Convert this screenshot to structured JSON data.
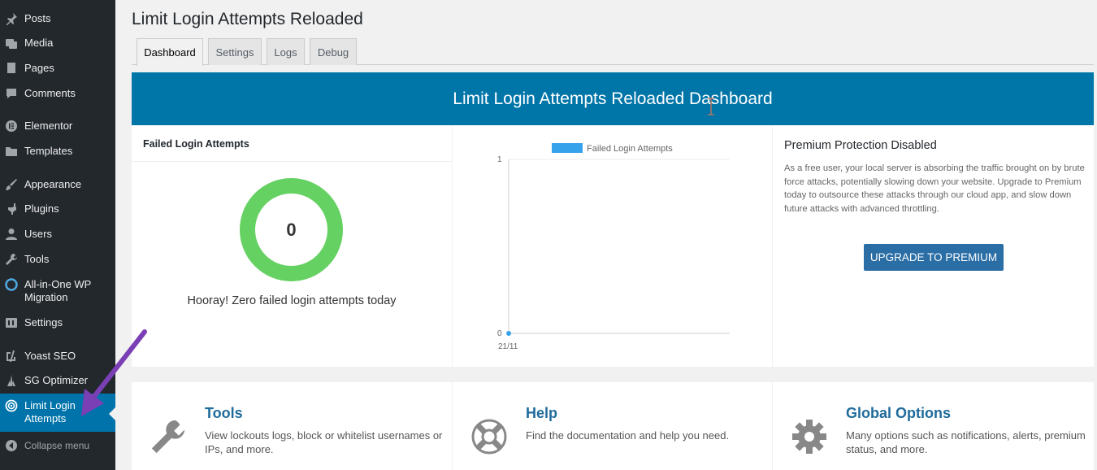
{
  "sidebar": {
    "items": [
      {
        "label": "Posts",
        "icon": "pin-icon"
      },
      {
        "label": "Media",
        "icon": "media-icon"
      },
      {
        "label": "Pages",
        "icon": "pages-icon"
      },
      {
        "label": "Comments",
        "icon": "comments-icon"
      },
      {
        "label": "Elementor",
        "icon": "elementor-icon"
      },
      {
        "label": "Templates",
        "icon": "folder-icon"
      },
      {
        "label": "Appearance",
        "icon": "brush-icon"
      },
      {
        "label": "Plugins",
        "icon": "plug-icon"
      },
      {
        "label": "Users",
        "icon": "user-icon"
      },
      {
        "label": "Tools",
        "icon": "wrench-icon"
      },
      {
        "label": "All-in-One WP Migration",
        "icon": "migration-icon"
      },
      {
        "label": "Settings",
        "icon": "settings-icon"
      },
      {
        "label": "Yoast SEO",
        "icon": "yoast-icon"
      },
      {
        "label": "SG Optimizer",
        "icon": "sg-icon"
      },
      {
        "label": "Limit Login Attempts",
        "icon": "llar-icon",
        "active": true
      }
    ],
    "collapse_label": "Collapse menu"
  },
  "page": {
    "title": "Limit Login Attempts Reloaded",
    "tabs": [
      {
        "label": "Dashboard",
        "active": true
      },
      {
        "label": "Settings"
      },
      {
        "label": "Logs"
      },
      {
        "label": "Debug"
      }
    ],
    "banner_title": "Limit Login Attempts Reloaded Dashboard"
  },
  "failed": {
    "heading": "Failed Login Attempts",
    "count": "0",
    "message": "Hooray! Zero failed login attempts today"
  },
  "chart_data": {
    "type": "line",
    "series": [
      {
        "name": "Failed Login Attempts",
        "values": [
          0
        ]
      }
    ],
    "x": [
      "21/11"
    ],
    "ylim": [
      0,
      1
    ],
    "yticks": [
      "0",
      "1"
    ],
    "legend": "top",
    "color": "#36a2eb"
  },
  "premium": {
    "title": "Premium Protection Disabled",
    "text": "As a free user, your local server is absorbing the traffic brought on by brute force attacks, potentially slowing down your website. Upgrade to Premium today to outsource these attacks through our cloud app, and slow down future attacks with advanced throttling.",
    "button": "UPGRADE TO PREMIUM"
  },
  "bottom": [
    {
      "title": "Tools",
      "text": "View lockouts logs, block or whitelist usernames or IPs, and more.",
      "icon": "wrench-icon"
    },
    {
      "title": "Help",
      "text": "Find the documentation and help you need.",
      "icon": "lifebuoy-icon"
    },
    {
      "title": "Global Options",
      "text": "Many options such as notifications, alerts, premium status, and more.",
      "icon": "gear-icon"
    }
  ],
  "colors": {
    "sidebar_bg": "#23282d",
    "active": "#0073aa",
    "banner": "#0075a8",
    "donut": "#66d163",
    "button": "#2a6ea5",
    "arrow": "#7b3fb5"
  }
}
